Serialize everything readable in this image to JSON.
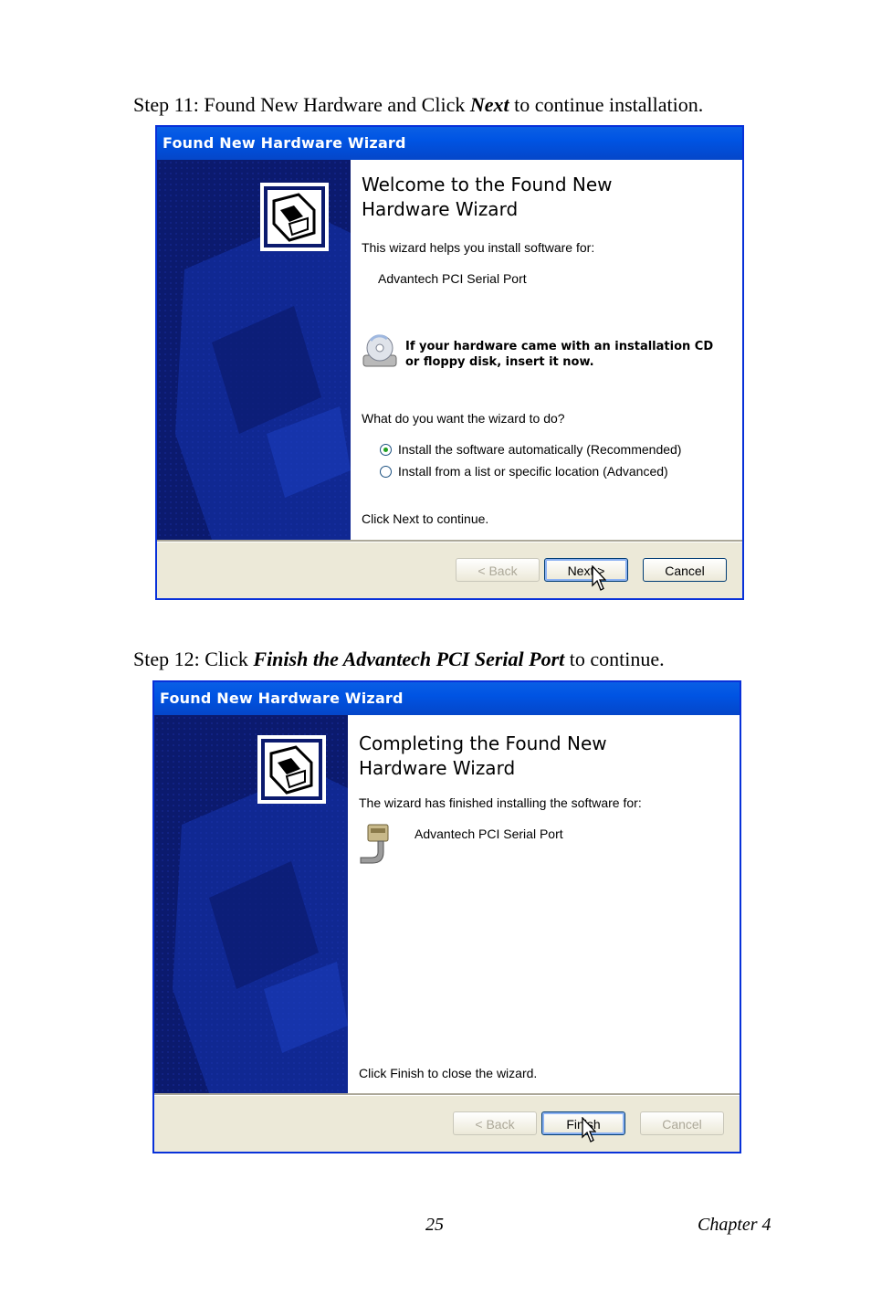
{
  "step11": {
    "prefix": "Step 11: Found New Hardware and Click ",
    "emph": "Next",
    "suffix": " to continue installation."
  },
  "step12": {
    "prefix": "Step 12: Click ",
    "emph": "Finish the Advantech PCI Serial Port",
    "suffix": " to continue."
  },
  "wizard1": {
    "title": "Found New Hardware Wizard",
    "heading_line1": "Welcome to the Found New",
    "heading_line2": "Hardware Wizard",
    "intro": "This wizard helps you install software for:",
    "device": "Advantech PCI Serial Port",
    "cd_line1": "If your hardware came with an installation CD",
    "cd_line2": "or floppy disk, insert it now.",
    "question": "What do you want the wizard to do?",
    "option_auto": "Install the software automatically (Recommended)",
    "option_list": "Install from a list or specific location (Advanced)",
    "selected_option": "auto",
    "footer": "Click Next to continue.",
    "back_label": "< Back",
    "next_label": "Next >",
    "cancel_label": "Cancel"
  },
  "wizard2": {
    "title": "Found New Hardware Wizard",
    "heading_line1": "Completing the Found New",
    "heading_line2": "Hardware Wizard",
    "intro": "The wizard has finished installing the software for:",
    "device": "Advantech PCI Serial Port",
    "footer": "Click Finish to close the wizard.",
    "back_label": "< Back",
    "finish_label": "Finish",
    "cancel_label": "Cancel"
  },
  "page_footer": {
    "page_number": "25",
    "chapter": "Chapter 4"
  },
  "colors": {
    "titlebar": "#0054e3",
    "sidebar": "#0b1a6e",
    "dialog_bg": "#ece9d8"
  }
}
